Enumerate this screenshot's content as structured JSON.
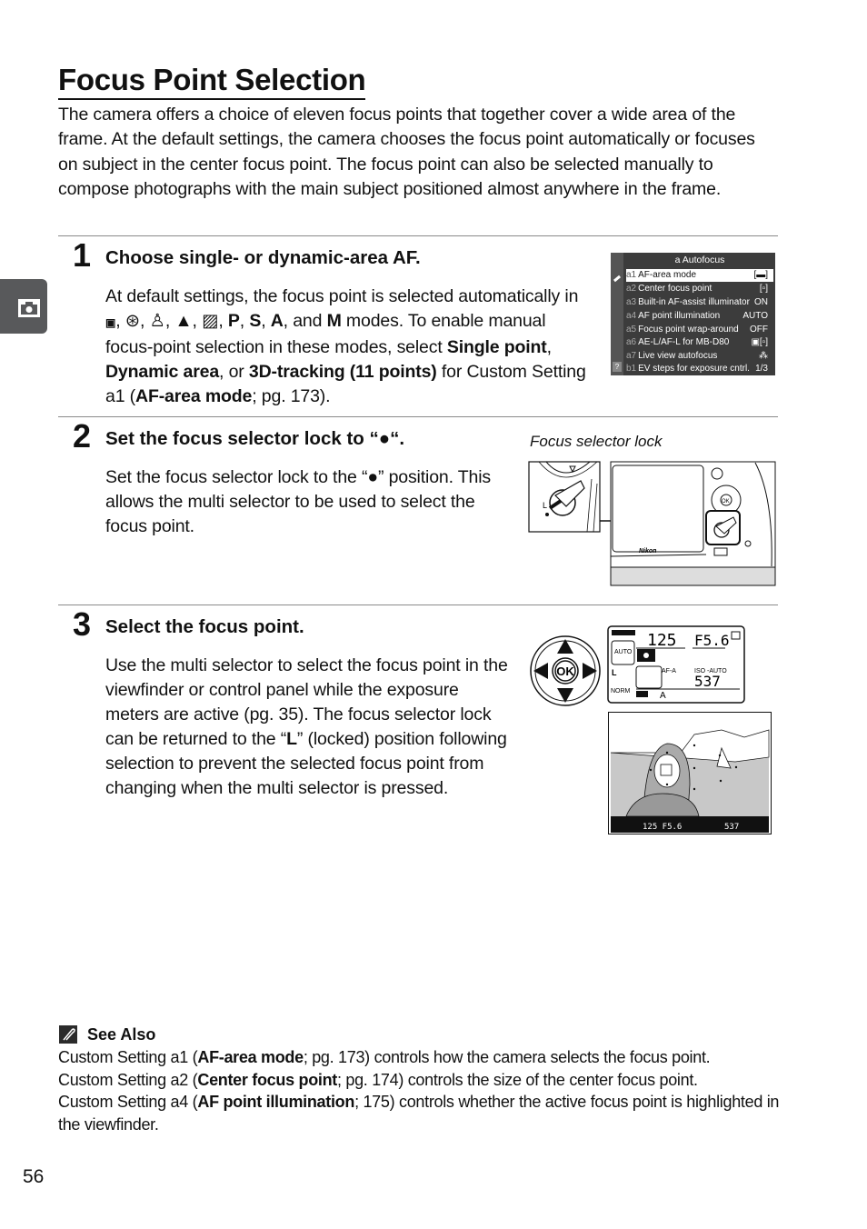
{
  "page": {
    "title": "Focus Point Selection",
    "intro": "The camera offers a choice of eleven focus points that together cover a wide area of the frame.  At the default settings, the camera chooses the focus point automatically or focuses on subject in the center focus point.  The focus point can also be selected manually to compose photographs with the main subject positioned almost anywhere in the frame.",
    "page_number": "56",
    "section_tab_icon": "camera-icon"
  },
  "steps": [
    {
      "number": "1",
      "title": "Choose single- or dynamic-area AF.",
      "text": {
        "p1": "At default settings, the focus point is selected automatically in ",
        "mode_icons": [
          "auto-mode-icon",
          "flash-off-mode-icon",
          "portrait-mode-icon",
          "landscape-mode-icon",
          "night-portrait-mode-icon"
        ],
        "modes_bold": [
          "P",
          "S",
          "A"
        ],
        "and": ", and ",
        "mode_m": "M",
        "p2": " modes.  To enable manual focus-point selection in these modes, select ",
        "opt1": "Single point",
        "sep1": ", ",
        "opt2": "Dynamic area",
        "sep2": ", or ",
        "opt3": "3D-tracking (11 points)",
        "p3": " for Custom Setting a1 (",
        "ref": "AF-area mode",
        "p4": "; pg. 173)."
      },
      "menu": {
        "title": "a Autofocus",
        "rows": [
          {
            "code": "a1",
            "label": "AF-area mode",
            "value": "[▬]",
            "selected": true
          },
          {
            "code": "a2",
            "label": "Center focus point",
            "value": "[▫]"
          },
          {
            "code": "a3",
            "label": "Built-in AF-assist illuminator",
            "value": "ON"
          },
          {
            "code": "a4",
            "label": "AF point illumination",
            "value": "AUTO"
          },
          {
            "code": "a5",
            "label": "Focus point wrap-around",
            "value": "OFF"
          },
          {
            "code": "a6",
            "label": "AE-L/AF-L for MB-D80",
            "value": "▣[▫]"
          },
          {
            "code": "a7",
            "label": "Live view autofocus",
            "value": "⁂"
          },
          {
            "code": "b1",
            "label": "EV steps for exposure cntrl.",
            "value": "1/3"
          }
        ]
      }
    },
    {
      "number": "2",
      "title": "Set the focus selector lock to “●“.",
      "text": "Set the focus selector lock to the “●” position. This allows the multi selector to be used to select the focus point.",
      "caption": "Focus selector lock",
      "illustration": {
        "brand": "Nikon",
        "lock_label": "L"
      }
    },
    {
      "number": "3",
      "title": "Select the focus point.",
      "text": {
        "p1": "Use the multi selector to select the focus point in the viewfinder or control panel while the exposure meters are active (pg. 35).  The focus selector lock can be returned to the “",
        "bold": "L",
        "p2": "” (locked) position following selection to prevent the selected focus point from changing when the multi selector is pressed."
      },
      "multi_selector": {
        "center": "OK"
      },
      "control_panel": {
        "shutter": "125",
        "aperture": "F5.6",
        "af_mode": "AF-A",
        "iso_label": "ISO -AUTO",
        "frames": "537",
        "auto": "AUTO",
        "size": "L",
        "quality": "NORM",
        "wb": "WB",
        "wb_value": "A"
      },
      "viewfinder": {
        "readout_left": "125  F5.6",
        "readout_right": "537"
      }
    }
  ],
  "see_also": {
    "title": "See Also",
    "items": [
      {
        "pre": "Custom Setting a1 (",
        "bold": "AF-area mode",
        "post": "; pg. 173) controls how the camera selects the focus point."
      },
      {
        "pre": "Custom Setting a2 (",
        "bold": "Center focus point",
        "post": "; pg. 174) controls the size of the center focus point."
      },
      {
        "pre": "Custom Setting a4 (",
        "bold": "AF point illumination",
        "post": "; 175) controls whether the active focus point is highlighted in the viewfinder."
      }
    ]
  }
}
